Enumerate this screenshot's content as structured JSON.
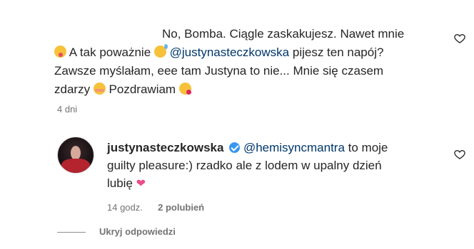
{
  "first_comment": {
    "line1": "No, Bomba. Ciągle zaskakujesz. Nawet mnie",
    "line2_pre": "A tak poważnie",
    "line2_mention": "@justynasteczkowska",
    "line2_post": "pijesz ten napój?",
    "line3": "Zawsze myślałam, eee tam Justyna to nie... Mnie się czasem",
    "line4_pre": "zdarzy",
    "line4_mid": "Pozdrawiam",
    "emojis": [
      "face-tongue-icon",
      "sweat-smile-icon",
      "blush-icon",
      "kiss-icon"
    ],
    "time": "4 dni"
  },
  "reply": {
    "username": "justynasteczkowska",
    "mention": "@hemisyncmantra",
    "text_line1_post": "to moje",
    "text_line2": "guilty pleasure:) rzadko ale z lodem w upalny dzień",
    "text_line3": "lubię",
    "heart_emoji": "❤",
    "time": "14 godz.",
    "likes": "2 polubień"
  },
  "hide_replies": "Ukryj odpowiedzi",
  "colors": {
    "mention": "#00376b",
    "meta": "#737373",
    "text": "#262626"
  }
}
